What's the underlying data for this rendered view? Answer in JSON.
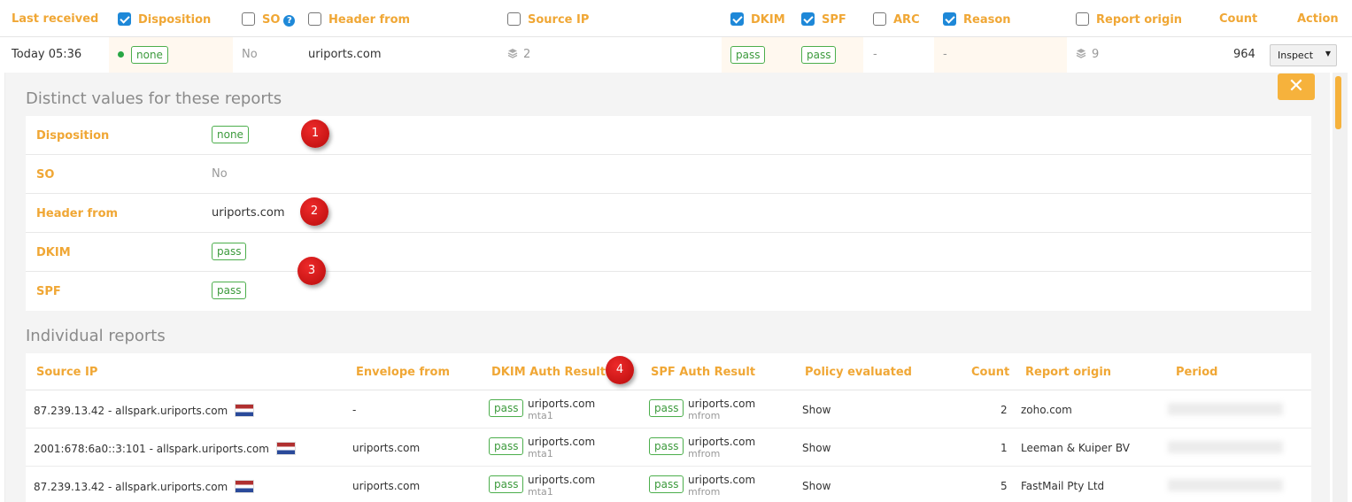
{
  "header": {
    "last_received": "Last received",
    "disposition": "Disposition",
    "so": "SO",
    "header_from": "Header from",
    "source_ip": "Source IP",
    "dkim": "DKIM",
    "spf": "SPF",
    "arc": "ARC",
    "reason": "Reason",
    "report_origin": "Report origin",
    "count": "Count",
    "action": "Action"
  },
  "summary": {
    "last_received": "Today 05:36",
    "disposition": "none",
    "so": "No",
    "header_from": "uriports.com",
    "source_ip_count": "2",
    "dkim": "pass",
    "spf": "pass",
    "arc": "-",
    "reason": "-",
    "report_origin_count": "9",
    "count": "964",
    "action": "Inspect"
  },
  "distinct": {
    "title": "Distinct values for these reports",
    "rows": [
      {
        "label": "Disposition",
        "value": "none"
      },
      {
        "label": "SO",
        "value": "No"
      },
      {
        "label": "Header from",
        "value": "uriports.com"
      },
      {
        "label": "DKIM",
        "value": "pass"
      },
      {
        "label": "SPF",
        "value": "pass"
      }
    ]
  },
  "reports": {
    "title": "Individual reports",
    "columns": {
      "source_ip": "Source IP",
      "envelope_from": "Envelope from",
      "dkim_auth": "DKIM Auth Result",
      "spf_auth": "SPF Auth Result",
      "policy": "Policy evaluated",
      "count": "Count",
      "report_origin": "Report origin",
      "period": "Period"
    },
    "rows": [
      {
        "source_ip": "87.239.13.42 - allspark.uriports.com",
        "envelope_from": "-",
        "dkim_result": "pass",
        "dkim_domain": "uriports.com",
        "dkim_selector": "mta1",
        "spf_result": "pass",
        "spf_domain": "uriports.com",
        "spf_scope": "mfrom",
        "policy": "Show",
        "count": "2",
        "report_origin": "zoho.com"
      },
      {
        "source_ip": "2001:678:6a0::3:101 - allspark.uriports.com",
        "envelope_from": "uriports.com",
        "dkim_result": "pass",
        "dkim_domain": "uriports.com",
        "dkim_selector": "mta1",
        "spf_result": "pass",
        "spf_domain": "uriports.com",
        "spf_scope": "mfrom",
        "policy": "Show",
        "count": "1",
        "report_origin": "Leeman & Kuiper BV"
      },
      {
        "source_ip": "87.239.13.42 - allspark.uriports.com",
        "envelope_from": "uriports.com",
        "dkim_result": "pass",
        "dkim_domain": "uriports.com",
        "dkim_selector": "mta1",
        "spf_result": "pass",
        "spf_domain": "uriports.com",
        "spf_scope": "mfrom",
        "policy": "Show",
        "count": "5",
        "report_origin": "FastMail Pty Ltd"
      }
    ]
  },
  "markers": [
    "1",
    "2",
    "3",
    "4"
  ],
  "colors": {
    "accent": "#f0a735",
    "pass": "#3c9a3c",
    "link": "#1e88d8",
    "marker": "#d81b1b"
  }
}
